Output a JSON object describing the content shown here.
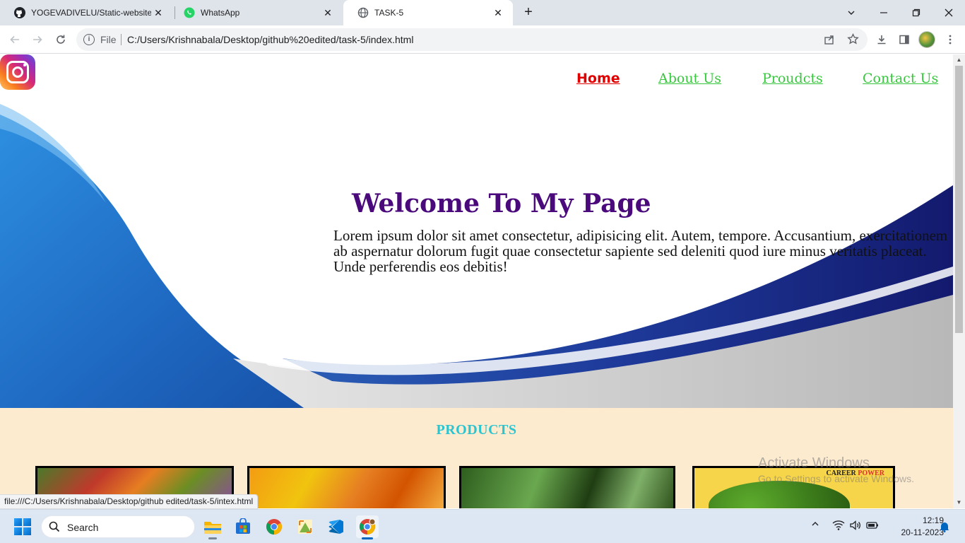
{
  "browser": {
    "tabs": [
      {
        "title": "YOGEVADIVELU/Static-website-c",
        "close": "✕"
      },
      {
        "title": "WhatsApp",
        "close": "✕"
      },
      {
        "title": "TASK-5",
        "close": "✕"
      }
    ],
    "new_tab": "+",
    "address": {
      "scheme_label": "File",
      "url": "C:/Users/Krishnabala/Desktop/github%20edited/task-5/index.html"
    },
    "status_url": "file:///C:/Users/Krishnabala/Desktop/github edited/task-5/intex.html"
  },
  "page": {
    "nav": {
      "home": "Home",
      "about": "About Us",
      "products": "Proudcts",
      "contact": "Contact Us"
    },
    "hero": {
      "title": "Welcome To My Page",
      "text": "Lorem ipsum dolor sit amet consectetur, adipisicing elit. Autem, tempore. Accusantium, exercitationem ab aspernatur dolorum fugit quae consectetur sapiente sed deleniti quod iure minus veritatis placeat. Unde perferendis eos debitis!"
    },
    "products": {
      "heading": "PRODUCTS",
      "card4_brand_a": "CAREER",
      "card4_brand_b": "POWER"
    },
    "colors": {
      "nav_active": "#e00000",
      "nav_link": "#39c63f",
      "title": "#4b0a7c",
      "products_heading": "#2bc4cf",
      "products_bg": "#fdebd0"
    }
  },
  "watermark": {
    "title": "Activate Windows",
    "subtitle": "Go to Settings to activate Windows."
  },
  "taskbar": {
    "search_placeholder": "Search",
    "time": "12:19",
    "date": "20-11-2023"
  }
}
